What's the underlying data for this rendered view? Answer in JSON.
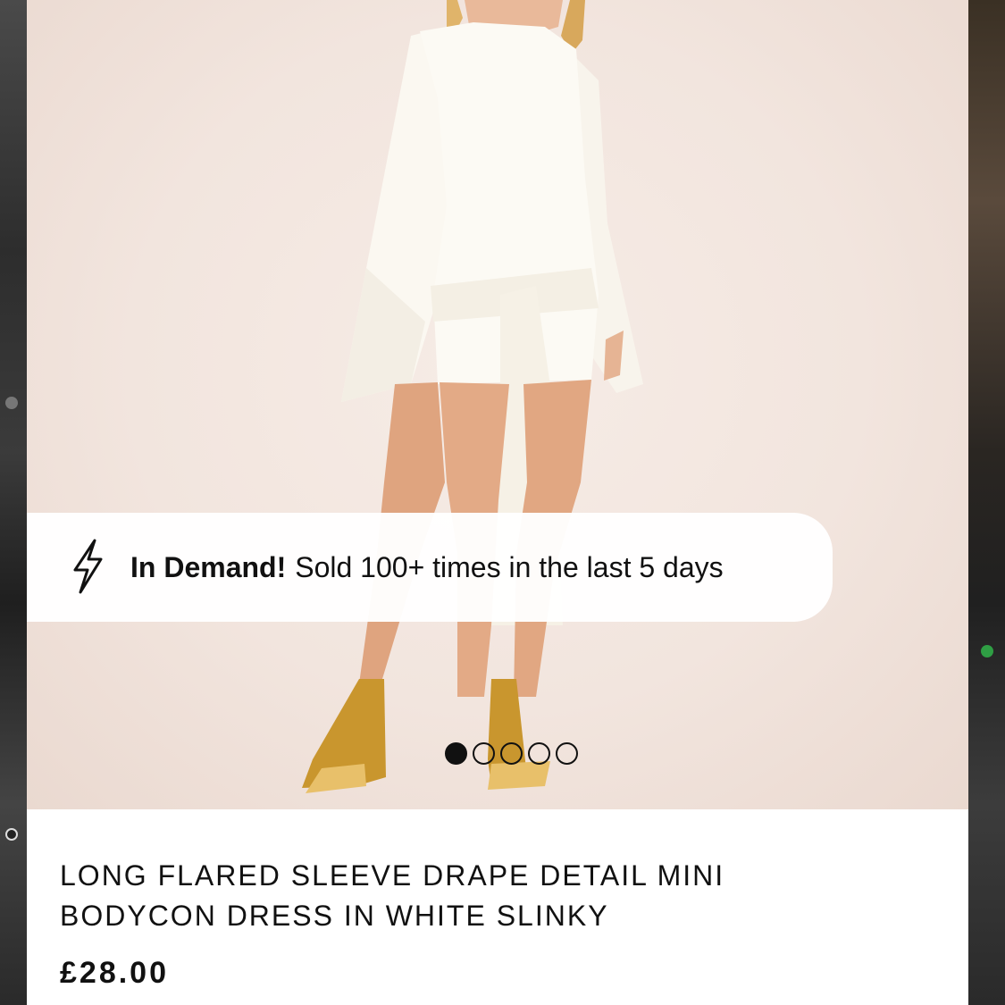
{
  "badge": {
    "icon": "lightning-bolt-icon",
    "strong": "In Demand!",
    "text": "Sold 100+ times in the last 5 days"
  },
  "carousel": {
    "count": 5,
    "active_index": 0
  },
  "product": {
    "title": "LONG FLARED SLEEVE DRAPE DETAIL MINI BODYCON DRESS IN WHITE SLINKY",
    "price": "£28.00"
  },
  "colors": {
    "background": "#f2e5de",
    "text": "#111111",
    "dress": "#fbf8f1",
    "sandals": "#c9962e"
  }
}
